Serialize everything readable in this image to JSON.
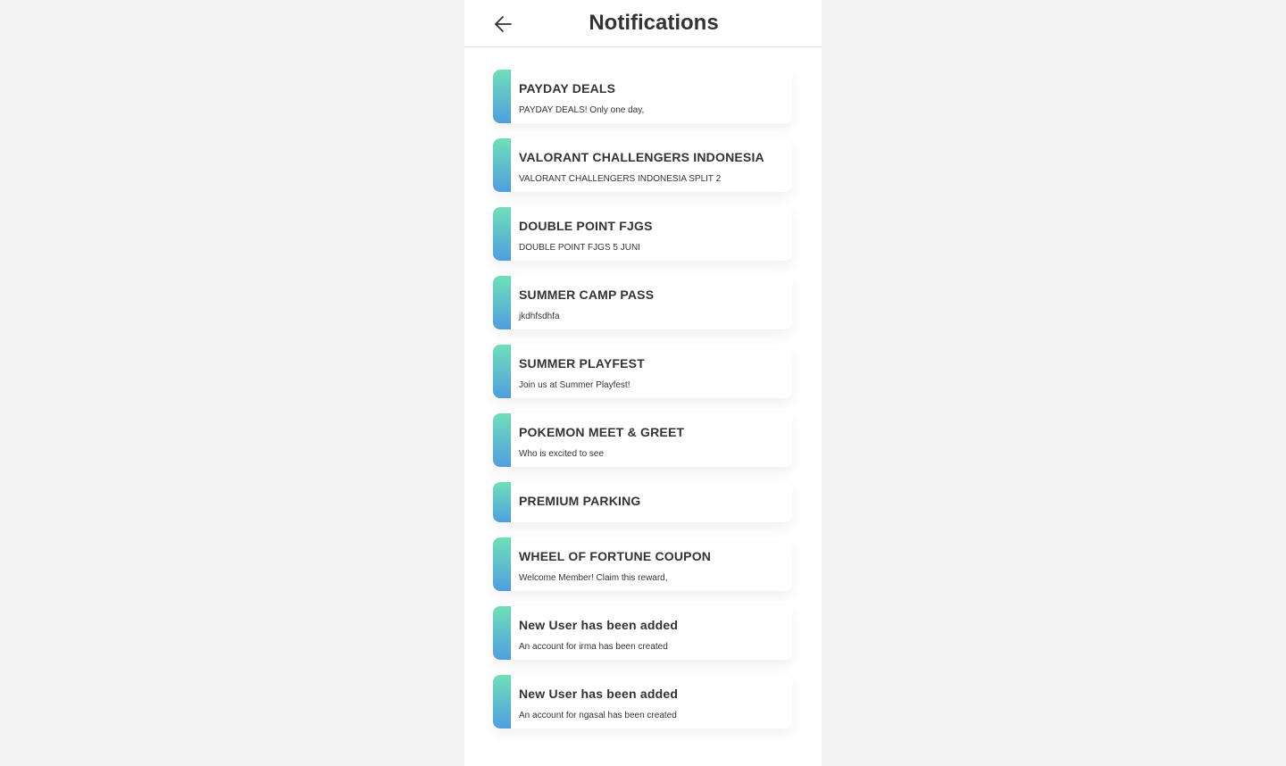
{
  "header": {
    "title": "Notifications",
    "back_icon": "arrow-left-icon"
  },
  "accent": {
    "gradient_top": "#6fe0b8",
    "gradient_bottom": "#4f9ee0",
    "text": "#333333",
    "background": "#f4f4f4"
  },
  "notifications": [
    {
      "title": "PAYDAY DEALS",
      "body": "PAYDAY DEALS! Only one day,"
    },
    {
      "title": "VALORANT CHALLENGERS INDONESIA",
      "body": "VALORANT CHALLENGERS INDONESIA SPLIT 2"
    },
    {
      "title": "DOUBLE POINT FJGS",
      "body": "DOUBLE POINT FJGS 5 JUNI"
    },
    {
      "title": "SUMMER CAMP PASS",
      "body": "jkdhfsdhfa"
    },
    {
      "title": "SUMMER PLAYFEST",
      "body": "Join us at Summer Playfest!"
    },
    {
      "title": "POKEMON MEET & GREET",
      "body": "Who is excited to see"
    },
    {
      "title": "PREMIUM PARKING",
      "body": ""
    },
    {
      "title": "WHEEL OF FORTUNE COUPON",
      "body": "Welcome Member! Claim this reward,"
    },
    {
      "title": "New User has been added",
      "body": "An account for irma has been created"
    },
    {
      "title": "New User has been added",
      "body": "An account for ngasal has been created"
    }
  ]
}
